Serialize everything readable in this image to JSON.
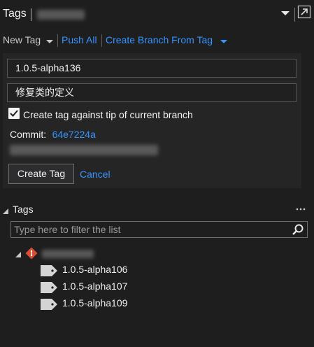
{
  "title": {
    "label": "Tags"
  },
  "toolbar": {
    "new_tag": "New Tag",
    "push_all": "Push All",
    "create_branch_from_tag": "Create Branch From Tag"
  },
  "form": {
    "tag_name": "1.0.5-alpha136",
    "message": "修复类的定义",
    "checkbox_label": "Create tag against tip of current branch",
    "commit_label": "Commit:",
    "commit_id": "64e7224a",
    "create_button": "Create Tag",
    "cancel_button": "Cancel"
  },
  "tags_section": {
    "title": "Tags",
    "filter_placeholder": "Type here to filter the list",
    "tags": [
      "1.0.5-alpha106",
      "1.0.5-alpha107",
      "1.0.5-alpha109"
    ]
  },
  "colors": {
    "background": "#1e1e1e",
    "panel": "#252526",
    "accent": "#3794ff",
    "repo_icon": "#d64f35"
  },
  "icons": {
    "title_dropdown": "chevron-down-icon",
    "pop_out": "pop-out-icon",
    "new_tag_dropdown": "chevron-down-icon",
    "branch_dropdown": "chevron-down-icon",
    "checkbox": "checkmark-icon",
    "section_collapse": "triangle-down-icon",
    "more": "more-options-icon",
    "search": "search-icon",
    "tree_collapse": "triangle-down-icon",
    "repo": "git-repo-icon",
    "tag": "tag-icon"
  }
}
